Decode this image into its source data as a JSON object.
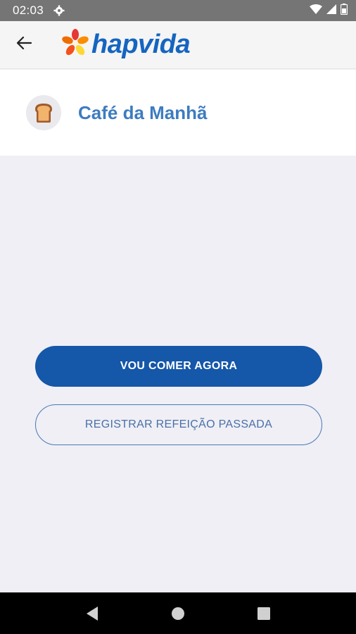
{
  "status_bar": {
    "time": "02:03",
    "icons": [
      "settings-icon",
      "wifi-icon",
      "signal-icon",
      "battery-icon"
    ]
  },
  "app_bar": {
    "back_icon": "arrow-left-icon",
    "logo_text": "hapvida"
  },
  "meal": {
    "icon": "toast-icon",
    "title": "Café da Manhã"
  },
  "actions": {
    "primary_label": "VOU COMER AGORA",
    "secondary_label": "REGISTRAR REFEIÇÃO PASSADA"
  },
  "nav": {
    "icons": [
      "back-triangle-icon",
      "home-circle-icon",
      "recents-square-icon"
    ]
  },
  "colors": {
    "primary": "#1557a8",
    "title": "#3d7cc0",
    "background": "#efeff5"
  }
}
